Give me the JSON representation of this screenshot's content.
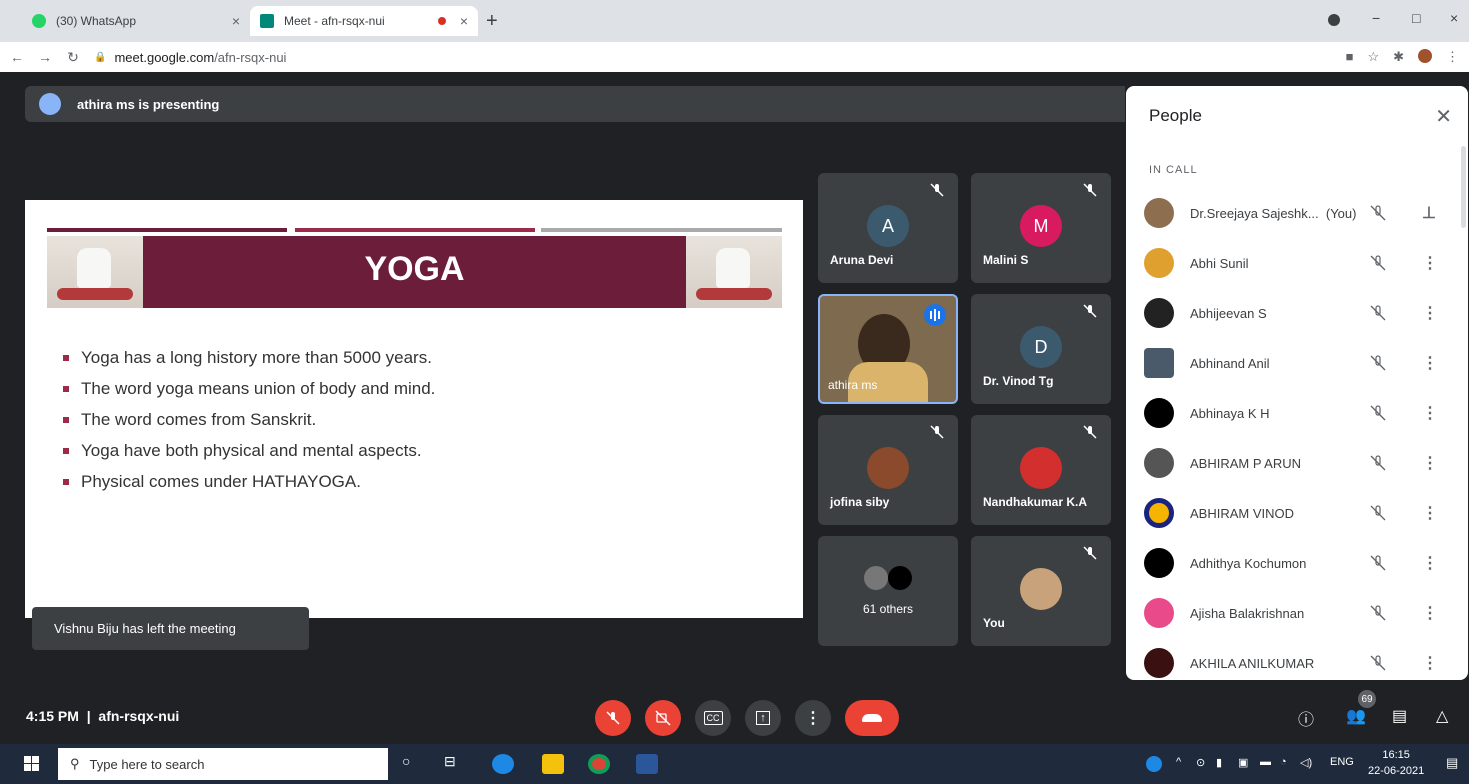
{
  "browser": {
    "tabs": [
      {
        "title": "(30) WhatsApp",
        "close": "×"
      },
      {
        "title": "Meet - afn-rsqx-nui",
        "close": "×"
      }
    ],
    "new_tab": "+",
    "url_host": "meet.google.com",
    "url_path": "/afn-rsqx-nui",
    "window_controls": [
      "−",
      "□",
      "×"
    ]
  },
  "meet": {
    "presenting_text": "athira ms is presenting",
    "slide": {
      "title": "YOGA",
      "bullets": [
        "Yoga has a long history more than 5000 years.",
        "The word yoga means union of body and mind.",
        "The word comes from Sanskrit.",
        "Yoga have both physical and mental aspects.",
        "Physical comes under HATHAYOGA."
      ]
    },
    "toast": "Vishnu Biju has left the meeting",
    "tiles": [
      {
        "name": "Aruna Devi",
        "initial": "A",
        "color": "#3c5a6e"
      },
      {
        "name": "Malini S",
        "initial": "M",
        "color": "#d81b60"
      },
      {
        "name": "athira ms"
      },
      {
        "name": "Dr. Vinod Tg",
        "initial": "D",
        "color": "#3c5a6e"
      },
      {
        "name": "jofina siby"
      },
      {
        "name": "Nandhakumar K.A"
      },
      {
        "name": "61 others"
      },
      {
        "name": "You"
      }
    ],
    "meeting_time": "4:15 PM",
    "meeting_code": "afn-rsqx-nui",
    "participant_count": "69"
  },
  "people_panel": {
    "title": "People",
    "section": "IN CALL",
    "participants": [
      {
        "name": "Dr.Sreejaya Sajeshk...",
        "you": "(You)"
      },
      {
        "name": "Abhi Sunil"
      },
      {
        "name": "Abhijeevan S"
      },
      {
        "name": "Abhinand Anil"
      },
      {
        "name": "Abhinaya K H"
      },
      {
        "name": "ABHIRAM P ARUN"
      },
      {
        "name": "ABHIRAM VINOD"
      },
      {
        "name": "Adhithya Kochumon"
      },
      {
        "name": "Ajisha Balakrishnan"
      },
      {
        "name": "AKHILA ANILKUMAR"
      }
    ]
  },
  "taskbar": {
    "search_placeholder": "Type here to search",
    "language": "ENG",
    "time": "16:15",
    "date": "22-06-2021"
  },
  "colors": {
    "meet_bg": "#202124",
    "tile_bg": "#3c4043",
    "danger": "#ea4335",
    "slide_banner": "#6b1d3a",
    "accent_blue": "#1a73e8"
  }
}
